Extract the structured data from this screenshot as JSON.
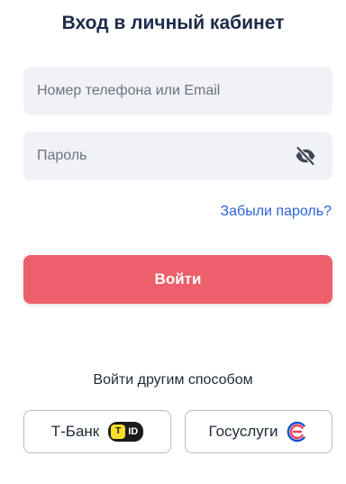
{
  "header": {
    "title": "Вход в личный кабинет"
  },
  "form": {
    "login_placeholder": "Номер телефона или Email",
    "login_value": "",
    "password_placeholder": "Пароль",
    "password_value": "",
    "forgot_label": "Забыли пароль?",
    "submit_label": "Войти"
  },
  "alternative": {
    "title": "Войти другим способом",
    "tbank_label": "Т-Банк",
    "tbank_badge_letter": "T",
    "tbank_badge_text": "ID",
    "gosuslugi_label": "Госуслуги"
  },
  "colors": {
    "accent": "#ec5f6b",
    "link": "#2d63d8",
    "title": "#1c2b4a",
    "field_bg": "#f1f2f6"
  },
  "icons": {
    "password_toggle": "eye-slash-icon",
    "tbank": "tbank-id-icon",
    "gosuslugi": "gosuslugi-logo-icon"
  }
}
